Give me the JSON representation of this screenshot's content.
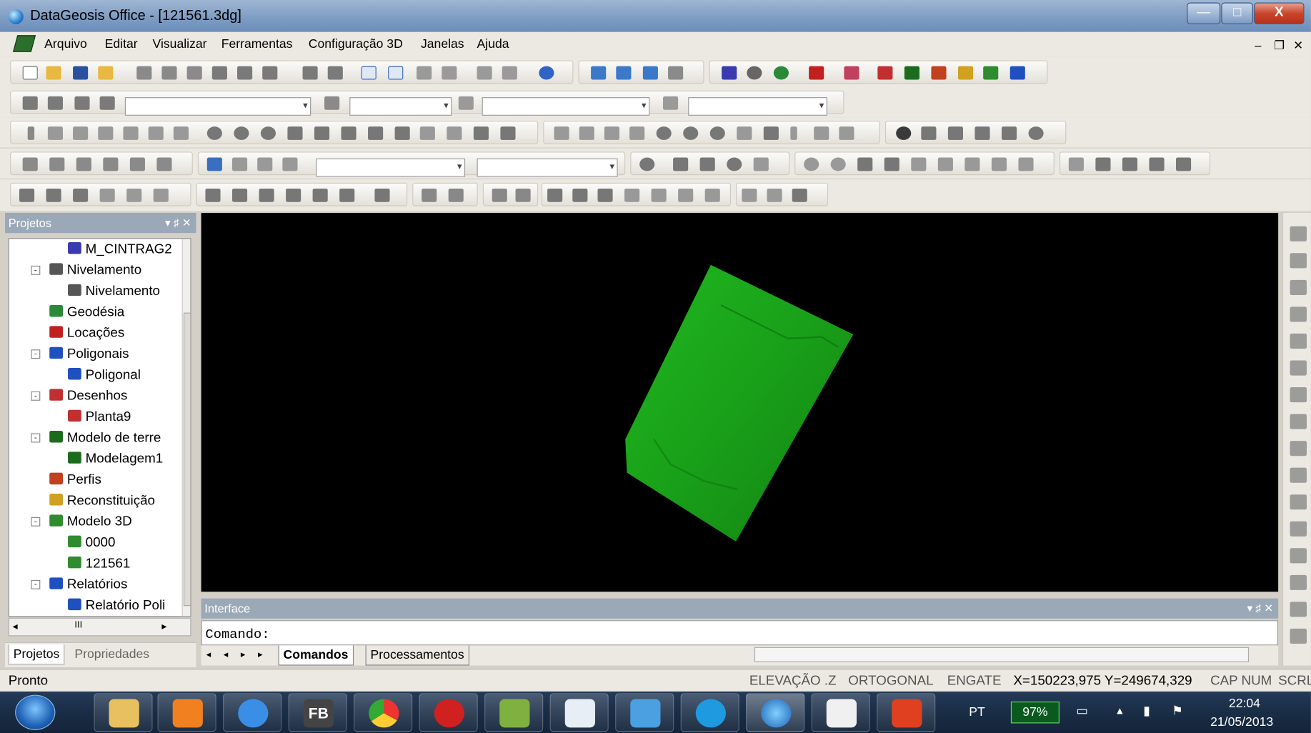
{
  "window": {
    "title": "DataGeosis Office - [121561.3dg]",
    "btn_min": "—",
    "btn_max": "□",
    "btn_close": "X"
  },
  "menu": {
    "items": [
      "Arquivo",
      "Editar",
      "Visualizar",
      "Ferramentas",
      "Configuração 3D",
      "Janelas",
      "Ajuda"
    ],
    "mdi_min": "–",
    "mdi_restore": "❐",
    "mdi_close": "✕"
  },
  "projects_panel": {
    "title": "Projetos",
    "pin": "▾ ♯ ✕",
    "tree": [
      {
        "label": "M_CINTRAG2",
        "indent": 2,
        "icon": "table-icon",
        "color": "#3a3ab0"
      },
      {
        "label": "Nivelamento",
        "indent": 1,
        "icon": "level-icon",
        "color": "#555",
        "exp": "-"
      },
      {
        "label": "Nivelamento",
        "indent": 2,
        "icon": "level-icon",
        "color": "#555"
      },
      {
        "label": "Geodésia",
        "indent": 1,
        "icon": "globe-icon",
        "color": "#2a8a3a"
      },
      {
        "label": "Locações",
        "indent": 1,
        "icon": "location-icon",
        "color": "#c02020"
      },
      {
        "label": "Poligonais",
        "indent": 1,
        "icon": "polygon-icon",
        "color": "#2050c0",
        "exp": "-"
      },
      {
        "label": "Poligonal",
        "indent": 2,
        "icon": "polygon-icon",
        "color": "#2050c0"
      },
      {
        "label": "Desenhos",
        "indent": 1,
        "icon": "drawing-icon",
        "color": "#c03030",
        "exp": "-"
      },
      {
        "label": "Planta9",
        "indent": 2,
        "icon": "drawing-icon",
        "color": "#c03030"
      },
      {
        "label": "Modelo de terre",
        "indent": 1,
        "icon": "terrain-icon",
        "color": "#1c6b1c",
        "exp": "-"
      },
      {
        "label": "Modelagem1",
        "indent": 2,
        "icon": "terrain-icon",
        "color": "#1c6b1c"
      },
      {
        "label": "Perfis",
        "indent": 1,
        "icon": "profile-icon",
        "color": "#c04020"
      },
      {
        "label": "Reconstituição",
        "indent": 1,
        "icon": "reconstruction-icon",
        "color": "#d0a020"
      },
      {
        "label": "Modelo 3D",
        "indent": 1,
        "icon": "model3d-icon",
        "color": "#2e8b2e",
        "exp": "-"
      },
      {
        "label": "0000",
        "indent": 2,
        "icon": "model3d-icon",
        "color": "#2e8b2e"
      },
      {
        "label": "121561",
        "indent": 2,
        "icon": "model3d-icon",
        "color": "#2e8b2e"
      },
      {
        "label": "Relatórios",
        "indent": 1,
        "icon": "report-icon",
        "color": "#2050c0",
        "exp": "-"
      },
      {
        "label": "Relatório Poli",
        "indent": 2,
        "icon": "report-icon",
        "color": "#2050c0"
      }
    ],
    "hscroll_thumb": "III",
    "tabs": [
      "Projetos",
      "Propriedades"
    ]
  },
  "interface_panel": {
    "title": "Interface",
    "prompt": "Comando:",
    "tabs": [
      "Comandos",
      "Processamentos"
    ],
    "nav": "◂ ◂ ▸ ▸"
  },
  "status": {
    "left": "Pronto",
    "cells": [
      "ELEVAÇÃO .Z",
      "ORTOGONAL",
      "ENGATE",
      "X=150223,975 Y=249674,329",
      "CAP",
      "NUM",
      "SCRL"
    ]
  },
  "taskbar": {
    "lang": "PT",
    "battery": "97%",
    "time": "22:04",
    "date": "21/05/2013"
  }
}
